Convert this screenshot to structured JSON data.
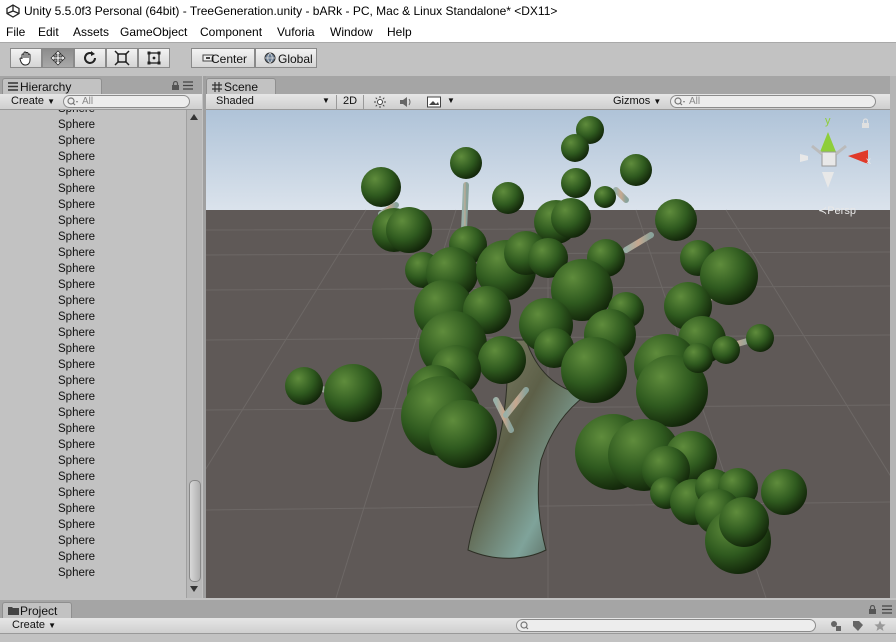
{
  "window": {
    "title": "Unity 5.5.0f3 Personal (64bit) - TreeGeneration.unity - bARk - PC, Mac & Linux Standalone* <DX11>"
  },
  "menu": [
    "File",
    "Edit",
    "Assets",
    "GameObject",
    "Component",
    "Vuforia",
    "Window",
    "Help"
  ],
  "toolbar": {
    "pivot_label": "Center",
    "space_label": "Global"
  },
  "hierarchy": {
    "tab_label": "Hierarchy",
    "create_label": "Create",
    "search_placeholder": "All",
    "items": [
      "Sphere",
      "Sphere",
      "Sphere",
      "Sphere",
      "Sphere",
      "Sphere",
      "Sphere",
      "Sphere",
      "Sphere",
      "Sphere",
      "Sphere",
      "Sphere",
      "Sphere",
      "Sphere",
      "Sphere",
      "Sphere",
      "Sphere",
      "Sphere",
      "Sphere",
      "Sphere",
      "Sphere",
      "Sphere",
      "Sphere",
      "Sphere",
      "Sphere",
      "Sphere",
      "Sphere",
      "Sphere",
      "Sphere",
      "Sphere"
    ]
  },
  "scene": {
    "tab_label": "Scene",
    "shading_mode": "Shaded",
    "mode_2d": "2D",
    "gizmos_label": "Gizmos",
    "search_placeholder": "All",
    "gizmo_axis_y": "y",
    "gizmo_axis_x": "x",
    "projection_label": "Persp"
  },
  "project": {
    "tab_label": "Project",
    "create_label": "Create"
  },
  "colors": {
    "foliage": "#2f5a1f",
    "ground": "#5f5957",
    "sky": "#c9d6e3",
    "panel": "#c2c2c2"
  }
}
